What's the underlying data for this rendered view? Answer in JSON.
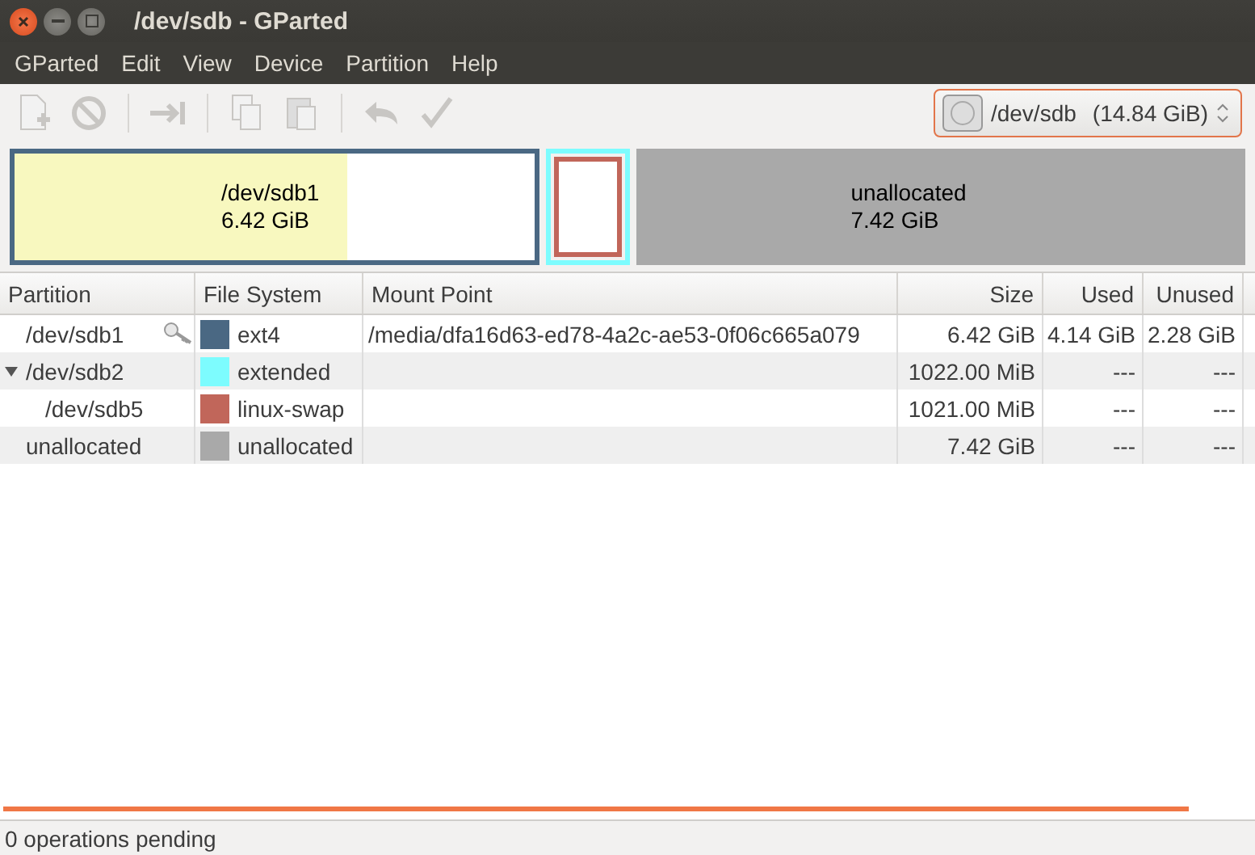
{
  "window": {
    "title": "/dev/sdb - GParted"
  },
  "menu": [
    "GParted",
    "Edit",
    "View",
    "Device",
    "Partition",
    "Help"
  ],
  "device_selector": {
    "value": "/dev/sdb",
    "size": "(14.84 GiB)"
  },
  "partition_map": [
    {
      "kind": "primary",
      "name": "/dev/sdb1",
      "size": "6.42 GiB",
      "color": "#4a6883",
      "level": 0.64
    },
    {
      "kind": "extended",
      "color": "#7dfcfe",
      "children": [
        {
          "kind": "logical",
          "color": "#c1665a"
        }
      ]
    },
    {
      "kind": "unallocated",
      "name": "unallocated",
      "size": "7.42 GiB",
      "color": "#a9a9a9"
    }
  ],
  "table": {
    "columns": [
      "Partition",
      "File System",
      "Mount Point",
      "Size",
      "Used",
      "Unused"
    ],
    "rows": [
      {
        "partition": "/dev/sdb1",
        "mounted": true,
        "color": "#4a6883",
        "file_system": "ext4",
        "mount_point": "/media/dfa16d63-ed78-4a2c-ae53-0f06c665a079",
        "size": "6.42 GiB",
        "used": "4.14 GiB",
        "unused": "2.28 GiB"
      },
      {
        "partition": "/dev/sdb2",
        "mounted": false,
        "expanded": true,
        "color": "#7dfcfe",
        "file_system": "extended",
        "size": "1022.00 MiB",
        "used": "---",
        "unused": "---",
        "children": [
          {
            "partition": "/dev/sdb5",
            "mounted": false,
            "color": "#c1665a",
            "file_system": "linux-swap",
            "size": "1021.00 MiB",
            "used": "---",
            "unused": "---"
          }
        ]
      },
      {
        "partition": "unallocated",
        "mounted": false,
        "color": "#a9a9a9",
        "file_system": "unallocated",
        "size": "7.42 GiB",
        "used": "---",
        "unused": "---"
      }
    ]
  },
  "status_bar": "0 operations pending"
}
